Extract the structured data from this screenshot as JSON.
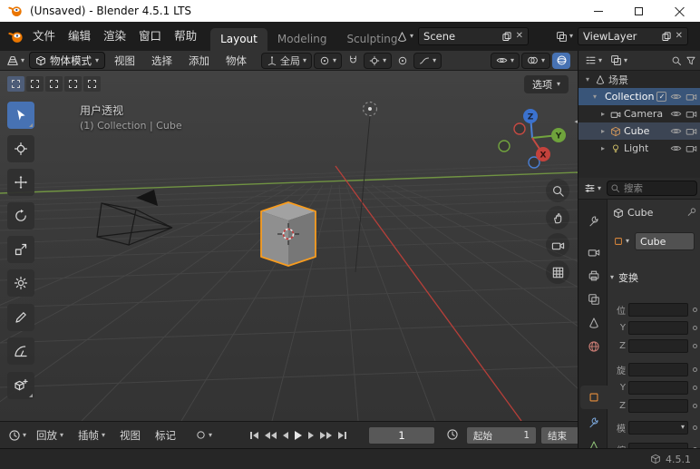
{
  "icons": {
    "caret_down": "▾",
    "caret_right": "▸",
    "arrow_left": "◂",
    "check": "✓",
    "close": "✕"
  },
  "titlebar": {
    "title": "(Unsaved) - Blender 4.5.1 LTS"
  },
  "topbar": {
    "menus": [
      "文件",
      "编辑",
      "渲染",
      "窗口",
      "帮助"
    ],
    "workspaces": [
      "Layout",
      "Modeling",
      "Sculpting"
    ],
    "scene_label": "Scene",
    "viewlayer_label": "ViewLayer"
  },
  "viewport_header": {
    "mode_label": "物体模式",
    "menus": [
      "视图",
      "选择",
      "添加",
      "物体"
    ],
    "orientation_label": "全局"
  },
  "tool_header": {
    "options_label": "选项"
  },
  "viewport": {
    "view_label": "用户透视",
    "context_label": "(1) Collection | Cube",
    "axis_x": "X",
    "axis_y": "Y",
    "axis_z": "Z"
  },
  "outliner": {
    "scene_label": "场景",
    "rows": [
      {
        "label": "Collection"
      },
      {
        "label": "Camera"
      },
      {
        "label": "Cube"
      },
      {
        "label": "Light"
      }
    ]
  },
  "properties": {
    "search_placeholder": "搜索",
    "breadcrumb_object": "Cube",
    "object_name": "Cube",
    "transform_panel_label": "变换",
    "transform_rows": [
      "位",
      "Y",
      "Z",
      "旋",
      "Y",
      "Z",
      "模",
      "缩"
    ]
  },
  "timeline": {
    "menus": [
      "回放",
      "插帧",
      "视图",
      "标记"
    ],
    "current_frame": "1",
    "start_label": "起始",
    "start_value": "1",
    "end_label": "结束"
  },
  "statusbar": {
    "version": "4.5.1"
  }
}
